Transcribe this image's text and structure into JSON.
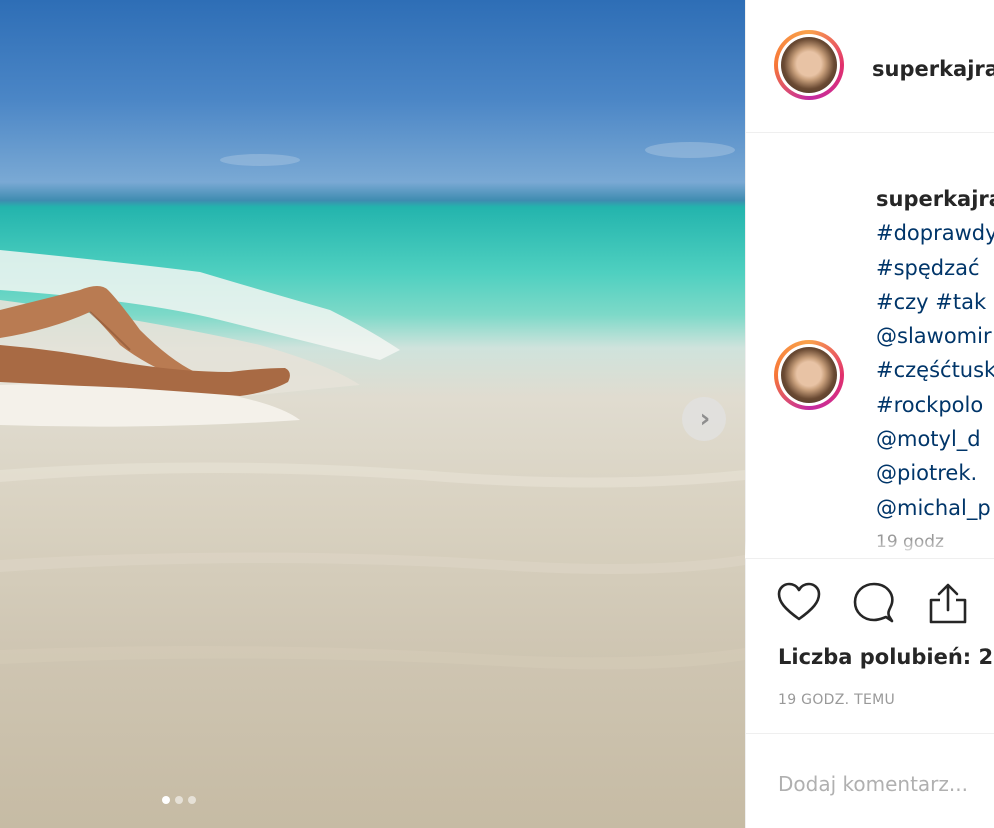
{
  "post": {
    "username": "superkajra",
    "carousel": {
      "current_index": 1,
      "total": 3
    }
  },
  "caption": {
    "author": "superkajra",
    "lines": [
      "#doprawdy",
      "#spędzać",
      "#czy #tak",
      "@slawomir",
      "#częśćtusk",
      "#rockpolo",
      "@motyl_d",
      "@piotrek.",
      "@michal_p"
    ],
    "time": "19 godz"
  },
  "actions": {
    "like_icon": "heart-icon",
    "comment_icon": "comment-icon",
    "share_icon": "share-icon"
  },
  "likes_text": "Liczba polubień: 2",
  "posted_time": "19 GODZ. TEMU",
  "comment": {
    "placeholder": "Dodaj komentarz..."
  },
  "colors": {
    "hashtag": "#003569",
    "text": "#262626",
    "muted": "#999999"
  }
}
